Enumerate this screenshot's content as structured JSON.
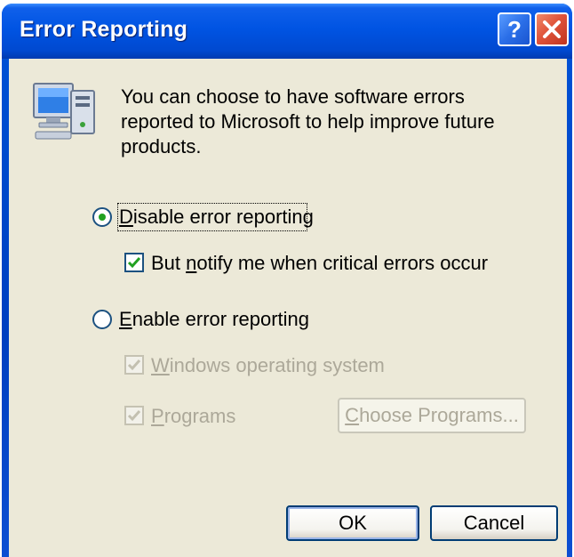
{
  "window": {
    "title": "Error Reporting"
  },
  "icons": {
    "computer": "computer-icon",
    "help": "help-icon",
    "close": "close-icon"
  },
  "description": {
    "line1": "You can choose to have software errors",
    "line2": "reported to Microsoft to help improve future",
    "line3": "products."
  },
  "options": {
    "disable": {
      "label_mnemonic": "D",
      "label_rest": "isable error reporting",
      "selected": true
    },
    "notify": {
      "label_pre": "But ",
      "label_mnemonic": "n",
      "label_rest": "otify me when critical errors occur",
      "checked": true
    },
    "enable": {
      "label_mnemonic": "E",
      "label_rest": "nable error reporting",
      "selected": false
    },
    "windows_os": {
      "label_mnemonic": "W",
      "label_rest": "indows operating system",
      "checked": true,
      "enabled": false
    },
    "programs": {
      "label_mnemonic": "P",
      "label_rest": "rograms",
      "checked": true,
      "enabled": false
    }
  },
  "buttons": {
    "choose_programs_mnemonic": "C",
    "choose_programs_rest": "hoose Programs...",
    "ok": "OK",
    "cancel": "Cancel"
  },
  "colors": {
    "titlebar": "#0054e3",
    "client_bg": "#ece9d8",
    "disabled_text": "#aca899",
    "check_green": "#21a121"
  }
}
